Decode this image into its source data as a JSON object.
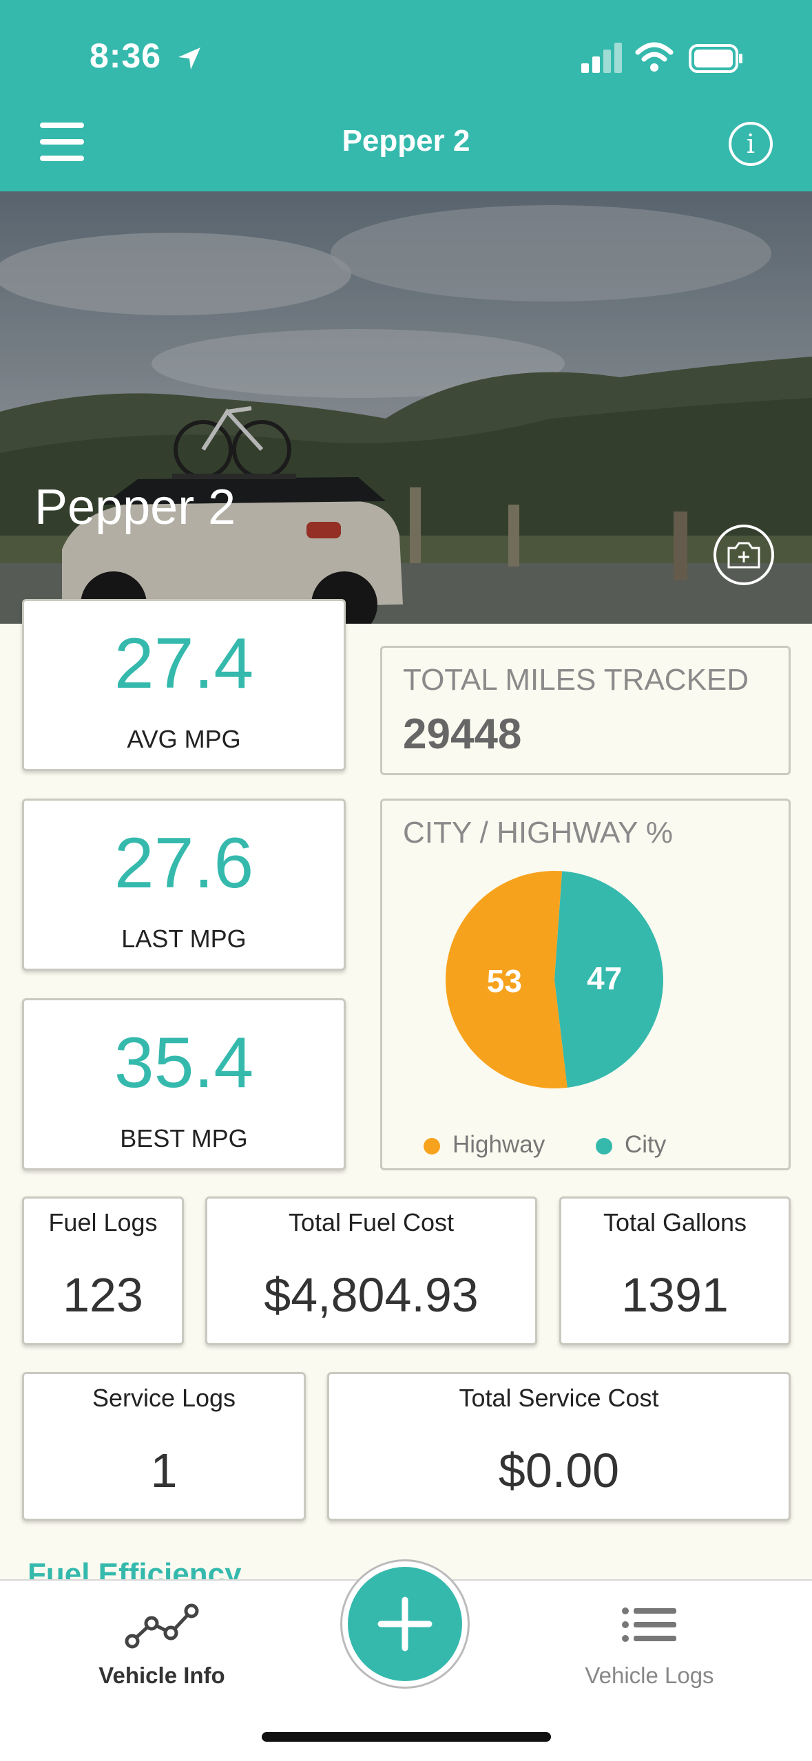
{
  "status": {
    "time": "8:36"
  },
  "header": {
    "title": "Pepper 2",
    "menu_icon": "hamburger-menu-icon",
    "info_icon": "info-icon"
  },
  "hero": {
    "vehicle_name": "Pepper 2",
    "photo_icon": "camera-add-icon"
  },
  "mpg": {
    "avg": {
      "value": "27.4",
      "label": "AVG MPG"
    },
    "last": {
      "value": "27.6",
      "label": "LAST MPG"
    },
    "best": {
      "value": "35.4",
      "label": "BEST MPG"
    }
  },
  "miles": {
    "title": "TOTAL MILES TRACKED",
    "value": "29448"
  },
  "city_highway": {
    "title": "CITY / HIGHWAY %",
    "legend": {
      "highway": "Highway",
      "city": "City"
    },
    "colors": {
      "highway": "#f7a21d",
      "city": "#35b9ad"
    }
  },
  "chart_data": {
    "type": "pie",
    "title": "CITY / HIGHWAY %",
    "categories": [
      "Highway",
      "City"
    ],
    "values": [
      53,
      47
    ],
    "labels": [
      "53",
      "47"
    ],
    "colors": [
      "#f7a21d",
      "#35b9ad"
    ],
    "legend": "bottom"
  },
  "stats": {
    "fuel_logs": {
      "label": "Fuel Logs",
      "value": "123"
    },
    "fuel_cost": {
      "label": "Total Fuel Cost",
      "value": "$4,804.93"
    },
    "gallons": {
      "label": "Total Gallons",
      "value": "1391"
    },
    "service_logs": {
      "label": "Service Logs",
      "value": "1"
    },
    "service_cost": {
      "label": "Total Service Cost",
      "value": "$0.00"
    }
  },
  "section_peek": "Fuel Efficiency",
  "tabbar": {
    "vehicle_info": "Vehicle Info",
    "vehicle_logs": "Vehicle Logs",
    "add_icon": "plus-icon"
  },
  "theme": {
    "accent": "#35b9ad",
    "background": "#fbfaf0"
  }
}
